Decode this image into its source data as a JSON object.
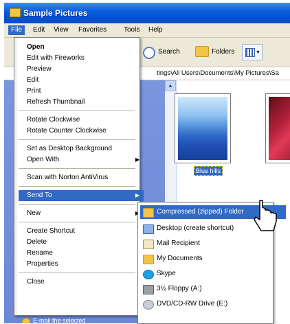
{
  "window": {
    "title": "Sample Pictures"
  },
  "menubar": {
    "items": [
      "File",
      "Edit",
      "View",
      "Favorites",
      "Tools",
      "Help"
    ]
  },
  "toolbar": {
    "search_label": "Search",
    "folders_label": "Folders"
  },
  "address": {
    "path": "tings\\All Users\\Documents\\My Pictures\\Sa"
  },
  "content": {
    "selected_item_label": "Blue hills"
  },
  "file_menu": {
    "open": "Open",
    "edit_with_fireworks": "Edit with Fireworks",
    "preview": "Preview",
    "edit": "Edit",
    "print": "Print",
    "refresh_thumbnail": "Refresh Thumbnail",
    "rotate_clockwise": "Rotate Clockwise",
    "rotate_counter_clockwise": "Rotate Counter Clockwise",
    "set_as_desktop_background": "Set as Desktop Background",
    "open_with": "Open With",
    "scan_with_norton": "Scan with Norton AntiVirus",
    "send_to": "Send To",
    "new": "New",
    "create_shortcut": "Create Shortcut",
    "delete": "Delete",
    "rename": "Rename",
    "properties": "Properties",
    "close": "Close"
  },
  "send_to_menu": {
    "compressed_folder": "Compressed (zipped) Folder",
    "desktop": "Desktop (create shortcut)",
    "mail_recipient": "Mail Recipient",
    "my_documents": "My Documents",
    "skype": "Skype",
    "floppy": "3½ Floppy (A:)",
    "dvd_drive": "DVD/CD-RW Drive (E:)"
  },
  "left_pane": {
    "task_email": "E-mail the selected"
  },
  "colors": {
    "titlebar": "#0a5fe0",
    "highlight": "#316ac5",
    "menu_bg": "#ffffff",
    "chrome": "#ece9d8",
    "left_pane": "#7a96df"
  }
}
